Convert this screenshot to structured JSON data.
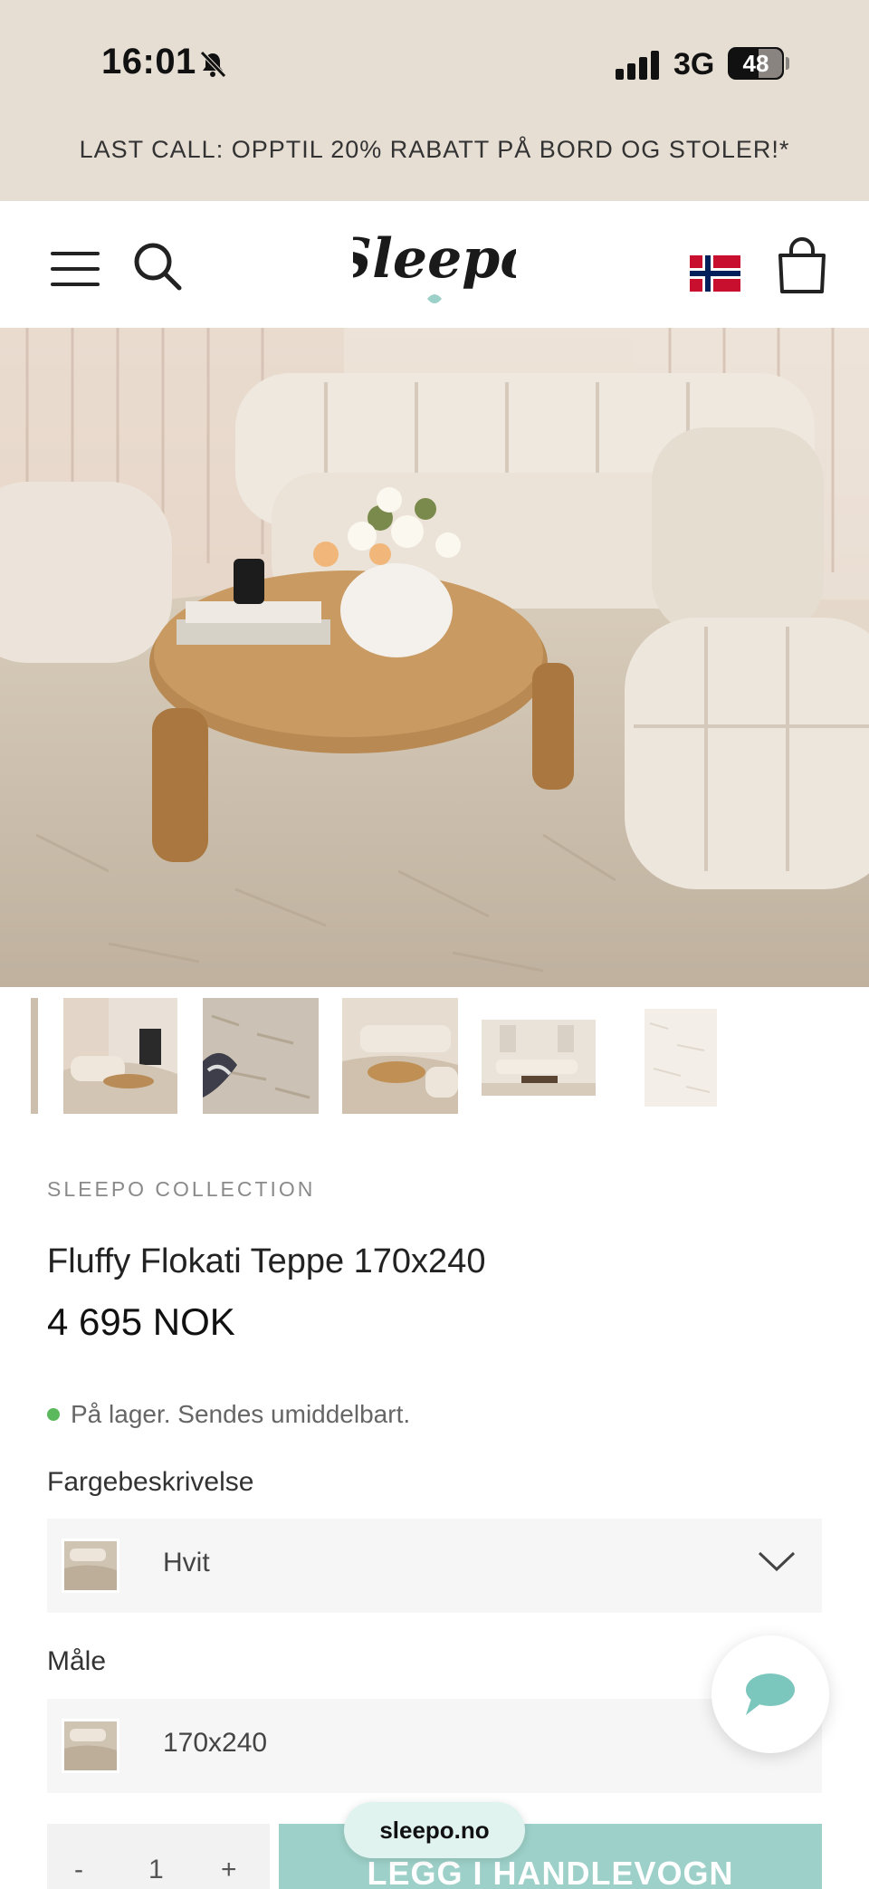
{
  "status_bar": {
    "time": "16:01",
    "network": "3G",
    "battery": "48"
  },
  "promo": {
    "text": "LAST CALL: OPPTIL 20% RABATT PÅ BORD OG STOLER!*"
  },
  "header": {
    "logo_text": "Sleepo"
  },
  "icons": {
    "menu": "hamburger-icon",
    "search": "search-icon",
    "logo": "sleepo-logo",
    "flag": "norway-flag-icon",
    "cart": "shopping-bag-icon",
    "chat": "chat-icon",
    "chevron": "chevron-down-icon",
    "bell": "bell-slash-icon"
  },
  "product": {
    "brand": "SLEEPO COLLECTION",
    "title": "Fluffy Flokati Teppe 170x240",
    "price": "4 695 NOK",
    "stock": "På lager. Sendes umiddelbart."
  },
  "options": {
    "color_label": "Fargebeskrivelse",
    "color_value": "Hvit",
    "size_label": "Måle",
    "size_value": "170x240"
  },
  "cart_row": {
    "minus": "-",
    "quantity": "1",
    "plus": "+",
    "add_to_cart": "LEGG I HANDLEVOGN"
  },
  "browser": {
    "url": "sleepo.no"
  },
  "colors": {
    "promo_bg": "#e6ddd3",
    "accent": "#9cd0c8",
    "stock_green": "#5cb85c",
    "flag_red": "#c8102e",
    "flag_blue": "#00205b"
  }
}
